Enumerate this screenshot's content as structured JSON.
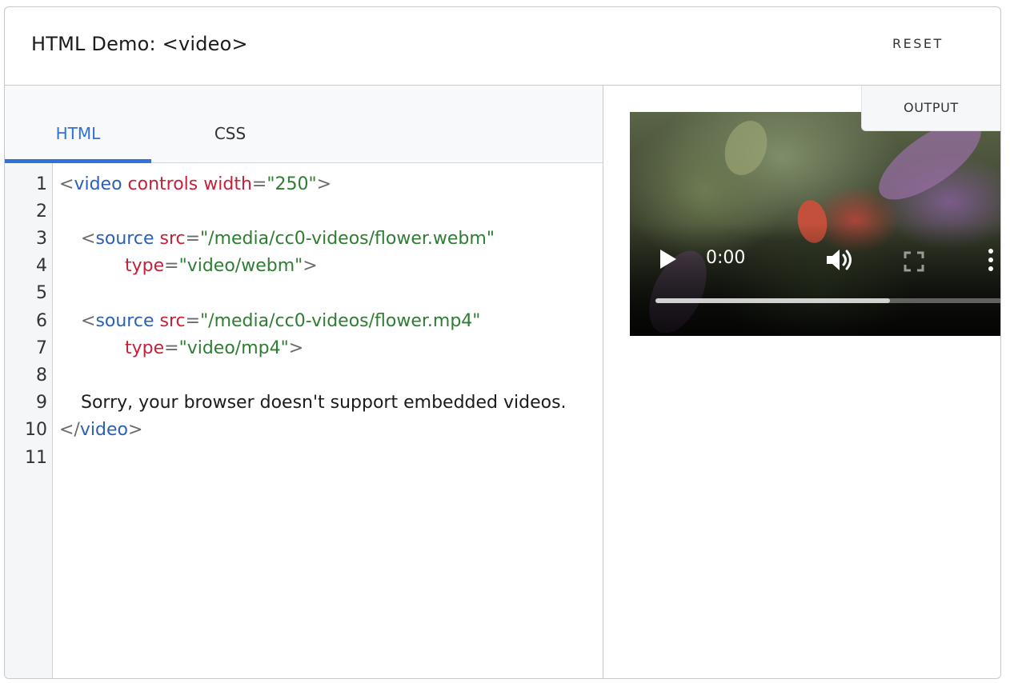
{
  "header": {
    "title": "HTML Demo: <video>",
    "reset_label": "RESET"
  },
  "editor": {
    "tabs": [
      {
        "label": "HTML",
        "active": true
      },
      {
        "label": "CSS",
        "active": false
      }
    ],
    "line_numbers": [
      "1",
      "2",
      "3",
      "4",
      "5",
      "6",
      "7",
      "8",
      "9",
      "10",
      "11"
    ],
    "code_lines": [
      "<video controls width=\"250\">",
      "",
      "  <source src=\"/media/cc0-videos/flower.webm\"",
      "      type=\"video/webm\">",
      "",
      "  <source src=\"/media/cc0-videos/flower.mp4\"",
      "      type=\"video/mp4\">",
      "",
      "  Sorry, your browser doesn't support embedded videos.",
      "</video>",
      ""
    ],
    "tokens": {
      "video": "video",
      "controls": "controls",
      "width": "width",
      "width_value": "\"250\"",
      "source": "source",
      "src": "src",
      "type": "type",
      "webm_src": "\"/media/cc0-videos/flower.webm\"",
      "webm_type": "\"video/webm\"",
      "mp4_src": "\"/media/cc0-videos/flower.mp4\"",
      "mp4_type": "\"video/mp4\"",
      "fallback_text": "Sorry, your browser doesn't support embedded videos."
    }
  },
  "output": {
    "tab_label": "OUTPUT",
    "video": {
      "current_time": "0:00",
      "buffered_fraction": 0.65,
      "controls": [
        "play-icon",
        "volume-icon",
        "fullscreen-icon",
        "more-options-icon"
      ]
    }
  },
  "colors": {
    "accent": "#3172d8",
    "tag": "#2b5fb8",
    "attribute": "#c6203a",
    "value": "#2e7d32"
  }
}
